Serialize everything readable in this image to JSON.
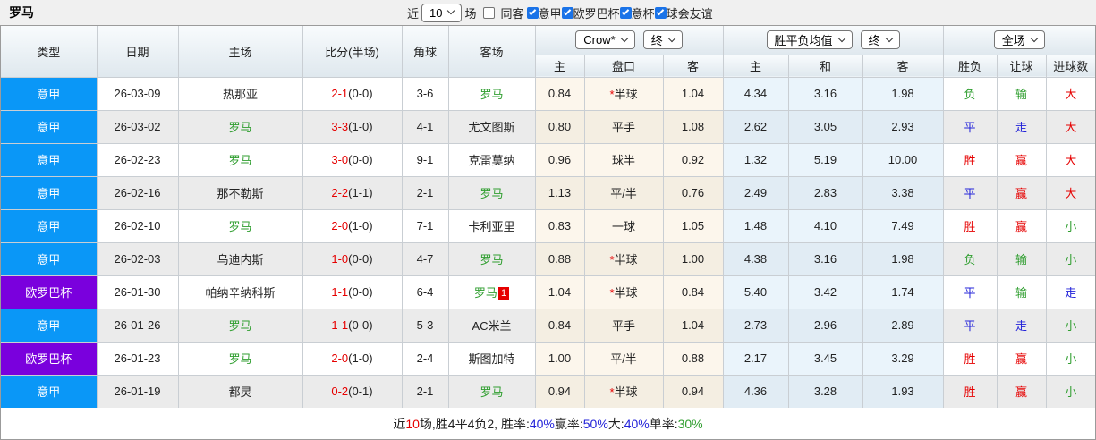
{
  "title": "罗马",
  "palette": {
    "league_blue": "#0a97f7",
    "league_purple": "#7a00dd",
    "red": "#e60000",
    "green": "#2f9e2f",
    "blue": "#2323d9",
    "black": "#222222"
  },
  "controls": {
    "recent_label": "近",
    "recent_value": "10",
    "matches_label": "场",
    "same_venue": {
      "label": "同客",
      "checked": false
    },
    "league_filters": [
      {
        "label": "意甲",
        "checked": true
      },
      {
        "label": "欧罗巴杯",
        "checked": true
      },
      {
        "label": "意杯",
        "checked": true
      },
      {
        "label": "球会友谊",
        "checked": true
      }
    ]
  },
  "table": {
    "main_headers": [
      "类型",
      "日期",
      "主场",
      "比分(半场)",
      "角球",
      "客场"
    ],
    "sub_headers": [
      "主",
      "盘口",
      "客",
      "主",
      "和",
      "客",
      "胜负",
      "让球",
      "进球数"
    ],
    "bookmaker_select": "Crow*",
    "ah_stage_select": "终",
    "europe_select": "胜平负均值",
    "eu_stage_select": "终",
    "scope_select": "全场",
    "rows": [
      {
        "league": "意甲",
        "league_color": "league_blue",
        "date": "26-03-09",
        "home": "热那亚",
        "home_self": false,
        "score": "2-1",
        "half": "(0-0)",
        "corners": "3-6",
        "away": "罗马",
        "away_self": true,
        "badge": "",
        "ah_star": true,
        "ah": [
          "0.84",
          "半球",
          "1.04"
        ],
        "eu": [
          "4.34",
          "3.16",
          "1.98"
        ],
        "outcome": [
          "负",
          "输",
          "大"
        ],
        "outcome_colors": [
          "green",
          "green",
          "red"
        ]
      },
      {
        "league": "意甲",
        "league_color": "league_blue",
        "date": "26-03-02",
        "home": "罗马",
        "home_self": true,
        "score": "3-3",
        "half": "(1-0)",
        "corners": "4-1",
        "away": "尤文图斯",
        "away_self": false,
        "badge": "",
        "ah_star": false,
        "ah": [
          "0.80",
          "平手",
          "1.08"
        ],
        "eu": [
          "2.62",
          "3.05",
          "2.93"
        ],
        "outcome": [
          "平",
          "走",
          "大"
        ],
        "outcome_colors": [
          "blue",
          "blue",
          "red"
        ]
      },
      {
        "league": "意甲",
        "league_color": "league_blue",
        "date": "26-02-23",
        "home": "罗马",
        "home_self": true,
        "score": "3-0",
        "half": "(0-0)",
        "corners": "9-1",
        "away": "克雷莫纳",
        "away_self": false,
        "badge": "",
        "ah_star": false,
        "ah": [
          "0.96",
          "球半",
          "0.92"
        ],
        "eu": [
          "1.32",
          "5.19",
          "10.00"
        ],
        "outcome": [
          "胜",
          "赢",
          "大"
        ],
        "outcome_colors": [
          "red",
          "red",
          "red"
        ]
      },
      {
        "league": "意甲",
        "league_color": "league_blue",
        "date": "26-02-16",
        "home": "那不勒斯",
        "home_self": false,
        "score": "2-2",
        "half": "(1-1)",
        "corners": "2-1",
        "away": "罗马",
        "away_self": true,
        "badge": "",
        "ah_star": false,
        "ah": [
          "1.13",
          "平/半",
          "0.76"
        ],
        "eu": [
          "2.49",
          "2.83",
          "3.38"
        ],
        "outcome": [
          "平",
          "赢",
          "大"
        ],
        "outcome_colors": [
          "blue",
          "red",
          "red"
        ]
      },
      {
        "league": "意甲",
        "league_color": "league_blue",
        "date": "26-02-10",
        "home": "罗马",
        "home_self": true,
        "score": "2-0",
        "half": "(1-0)",
        "corners": "7-1",
        "away": "卡利亚里",
        "away_self": false,
        "badge": "",
        "ah_star": false,
        "ah": [
          "0.83",
          "一球",
          "1.05"
        ],
        "eu": [
          "1.48",
          "4.10",
          "7.49"
        ],
        "outcome": [
          "胜",
          "赢",
          "小"
        ],
        "outcome_colors": [
          "red",
          "red",
          "green"
        ]
      },
      {
        "league": "意甲",
        "league_color": "league_blue",
        "date": "26-02-03",
        "home": "乌迪内斯",
        "home_self": false,
        "score": "1-0",
        "half": "(0-0)",
        "corners": "4-7",
        "away": "罗马",
        "away_self": true,
        "badge": "",
        "ah_star": true,
        "ah": [
          "0.88",
          "半球",
          "1.00"
        ],
        "eu": [
          "4.38",
          "3.16",
          "1.98"
        ],
        "outcome": [
          "负",
          "输",
          "小"
        ],
        "outcome_colors": [
          "green",
          "green",
          "green"
        ]
      },
      {
        "league": "欧罗巴杯",
        "league_color": "league_purple",
        "date": "26-01-30",
        "home": "帕纳辛纳科斯",
        "home_self": false,
        "score": "1-1",
        "half": "(0-0)",
        "corners": "6-4",
        "away": "罗马",
        "away_self": true,
        "badge": "1",
        "ah_star": true,
        "ah": [
          "1.04",
          "半球",
          "0.84"
        ],
        "eu": [
          "5.40",
          "3.42",
          "1.74"
        ],
        "outcome": [
          "平",
          "输",
          "走"
        ],
        "outcome_colors": [
          "blue",
          "green",
          "blue"
        ]
      },
      {
        "league": "意甲",
        "league_color": "league_blue",
        "date": "26-01-26",
        "home": "罗马",
        "home_self": true,
        "score": "1-1",
        "half": "(0-0)",
        "corners": "5-3",
        "away": "AC米兰",
        "away_self": false,
        "badge": "",
        "ah_star": false,
        "ah": [
          "0.84",
          "平手",
          "1.04"
        ],
        "eu": [
          "2.73",
          "2.96",
          "2.89"
        ],
        "outcome": [
          "平",
          "走",
          "小"
        ],
        "outcome_colors": [
          "blue",
          "blue",
          "green"
        ]
      },
      {
        "league": "欧罗巴杯",
        "league_color": "league_purple",
        "date": "26-01-23",
        "home": "罗马",
        "home_self": true,
        "score": "2-0",
        "half": "(1-0)",
        "corners": "2-4",
        "away": "斯图加特",
        "away_self": false,
        "badge": "",
        "ah_star": false,
        "ah": [
          "1.00",
          "平/半",
          "0.88"
        ],
        "eu": [
          "2.17",
          "3.45",
          "3.29"
        ],
        "outcome": [
          "胜",
          "赢",
          "小"
        ],
        "outcome_colors": [
          "red",
          "red",
          "green"
        ]
      },
      {
        "league": "意甲",
        "league_color": "league_blue",
        "date": "26-01-19",
        "home": "都灵",
        "home_self": false,
        "score": "0-2",
        "half": "(0-1)",
        "corners": "2-1",
        "away": "罗马",
        "away_self": true,
        "badge": "",
        "ah_star": true,
        "ah": [
          "0.94",
          "半球",
          "0.94"
        ],
        "eu": [
          "4.36",
          "3.28",
          "1.93"
        ],
        "outcome": [
          "胜",
          "赢",
          "小"
        ],
        "outcome_colors": [
          "red",
          "red",
          "green"
        ]
      }
    ]
  },
  "footer": {
    "segments": [
      {
        "text": "近",
        "color": "black"
      },
      {
        "text": "10",
        "color": "red"
      },
      {
        "text": "场,胜4平4负2, 胜率:",
        "color": "black"
      },
      {
        "text": "40%",
        "color": "blue"
      },
      {
        "text": " 赢率:",
        "color": "black"
      },
      {
        "text": "50%",
        "color": "blue"
      },
      {
        "text": " 大:",
        "color": "black"
      },
      {
        "text": "40%",
        "color": "blue"
      },
      {
        "text": " 单率:",
        "color": "black"
      },
      {
        "text": "30%",
        "color": "green"
      }
    ]
  }
}
